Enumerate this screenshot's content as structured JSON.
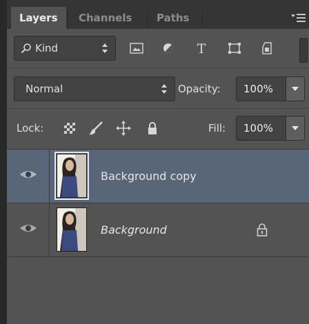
{
  "tabs": {
    "layers": "Layers",
    "channels": "Channels",
    "paths": "Paths"
  },
  "filter": {
    "kind_label": "Kind",
    "icons": [
      "image-filter-icon",
      "adjustment-filter-icon",
      "type-filter-icon",
      "shape-filter-icon",
      "smart-object-filter-icon"
    ]
  },
  "blend": {
    "mode": "Normal",
    "opacity_label": "Opacity:",
    "opacity_value": "100%"
  },
  "lock": {
    "label": "Lock:",
    "fill_label": "Fill:",
    "fill_value": "100%"
  },
  "layers": [
    {
      "name": "Background copy",
      "selected": true,
      "visible": true,
      "locked": false
    },
    {
      "name": "Background",
      "selected": false,
      "visible": true,
      "locked": true
    }
  ],
  "colors": {
    "panel": "#535353",
    "selected_row": "#596679",
    "tab_bar": "#353535"
  }
}
